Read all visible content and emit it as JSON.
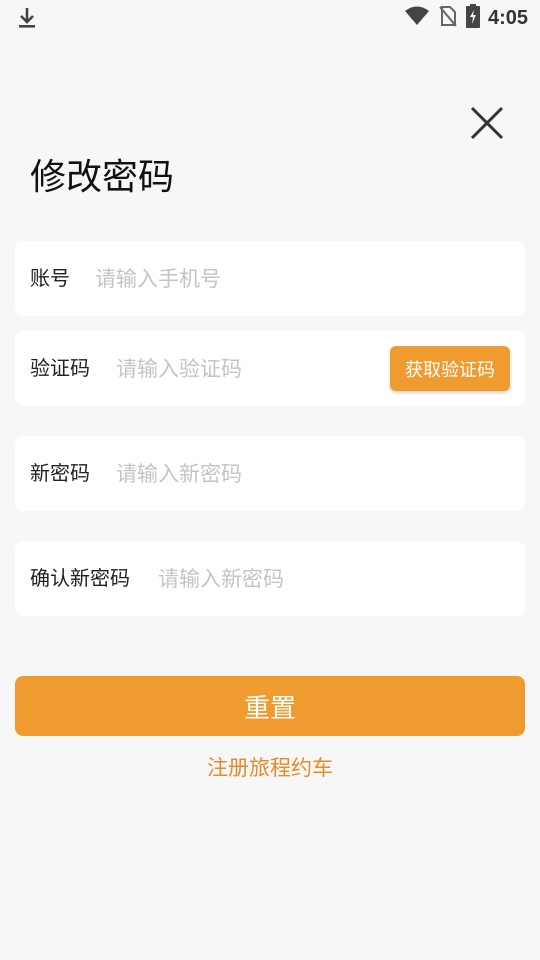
{
  "status_bar": {
    "time": "4:05",
    "icons": [
      "download-icon",
      "wifi-icon",
      "no-sim-icon",
      "battery-charging-icon"
    ]
  },
  "page": {
    "title": "修改密码",
    "close_icon": "close-icon"
  },
  "form": {
    "account": {
      "label": "账号",
      "placeholder": "请输入手机号",
      "value": ""
    },
    "code": {
      "label": "验证码",
      "placeholder": "请输入验证码",
      "value": "",
      "button_label": "获取验证码"
    },
    "new_password": {
      "label": "新密码",
      "placeholder": "请输入新密码",
      "value": ""
    },
    "confirm_password": {
      "label": "确认新密码",
      "placeholder": "请输入新密码",
      "value": ""
    }
  },
  "actions": {
    "reset_label": "重置",
    "register_label": "注册旅程约车"
  },
  "colors": {
    "accent": "#f09b2f",
    "link": "#e8892a",
    "background": "#f7f7f7",
    "card": "#ffffff",
    "placeholder": "#c4c4c4"
  }
}
